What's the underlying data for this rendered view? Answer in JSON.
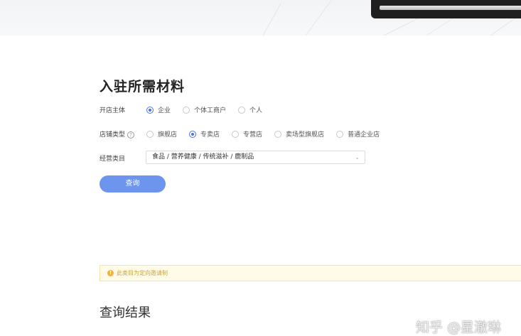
{
  "page": {
    "title": "入驻所需材料",
    "results_title": "查询结果"
  },
  "store_subject": {
    "label": "开店主体",
    "options": [
      {
        "label": "企业",
        "checked": true
      },
      {
        "label": "个体工商户",
        "checked": false
      },
      {
        "label": "个人",
        "checked": false
      }
    ]
  },
  "store_type": {
    "label": "店铺类型",
    "help_icon": "?",
    "options": [
      {
        "label": "旗舰店",
        "checked": false
      },
      {
        "label": "专卖店",
        "checked": true
      },
      {
        "label": "专营店",
        "checked": false
      },
      {
        "label": "卖场型旗舰店",
        "checked": false
      },
      {
        "label": "普通企业店",
        "checked": false
      }
    ]
  },
  "category": {
    "label": "经营类目",
    "value": "食品 / 营养健康 / 传统滋补 / 鹿制品",
    "chevron_icon": "⌄"
  },
  "query_button": {
    "label": "查询"
  },
  "notice": {
    "icon": "!",
    "text": "此类目为定向邀请制"
  },
  "watermark": {
    "text": "知乎 @星澈琳"
  },
  "colors": {
    "accent": "#4a72e8",
    "button": "#6e95ee",
    "notice_bg": "#fffbe6",
    "notice_text": "#c9a33a"
  }
}
